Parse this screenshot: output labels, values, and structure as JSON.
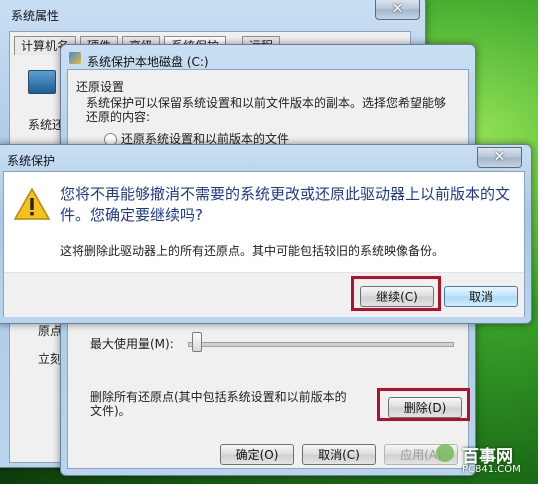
{
  "sys_props": {
    "title": "系统属性",
    "close": "✕",
    "tabs": [
      "计算机名",
      "硬件",
      "高级",
      "系统保护",
      "远程"
    ],
    "side_texts": [
      "系统还",
      "原点",
      "立刻"
    ]
  },
  "local_disk": {
    "title": "系统保护本地磁盘 (C:)",
    "restore_heading": "还原设置",
    "restore_desc": "系统保护可以保留系统设置和以前文件版本的副本。选择您希望能够还原的内容:",
    "option1": "还原系统设置和以前版本的文件",
    "max_usage_label": "最大使用量(M):",
    "delete_desc": "删除所有还原点(其中包括系统设置和以前版本的文件)。",
    "delete_button": "删除(D)",
    "ok_button": "确定(O)",
    "cancel_button": "取消(C)",
    "apply_button": "应用(A)"
  },
  "confirm": {
    "title": "系统保护",
    "close": "✕",
    "main_text": "您将不再能够撤消不需要的系统更改或还原此驱动器上以前版本的文件。您确定要继续吗?",
    "sub_text": "这将删除此驱动器上的所有还原点。其中可能包括较旧的系统映像备份。",
    "continue_button": "继续(C)",
    "cancel_button": "取消"
  },
  "watermark": {
    "text": "百事网",
    "url": "PC841.COM"
  }
}
